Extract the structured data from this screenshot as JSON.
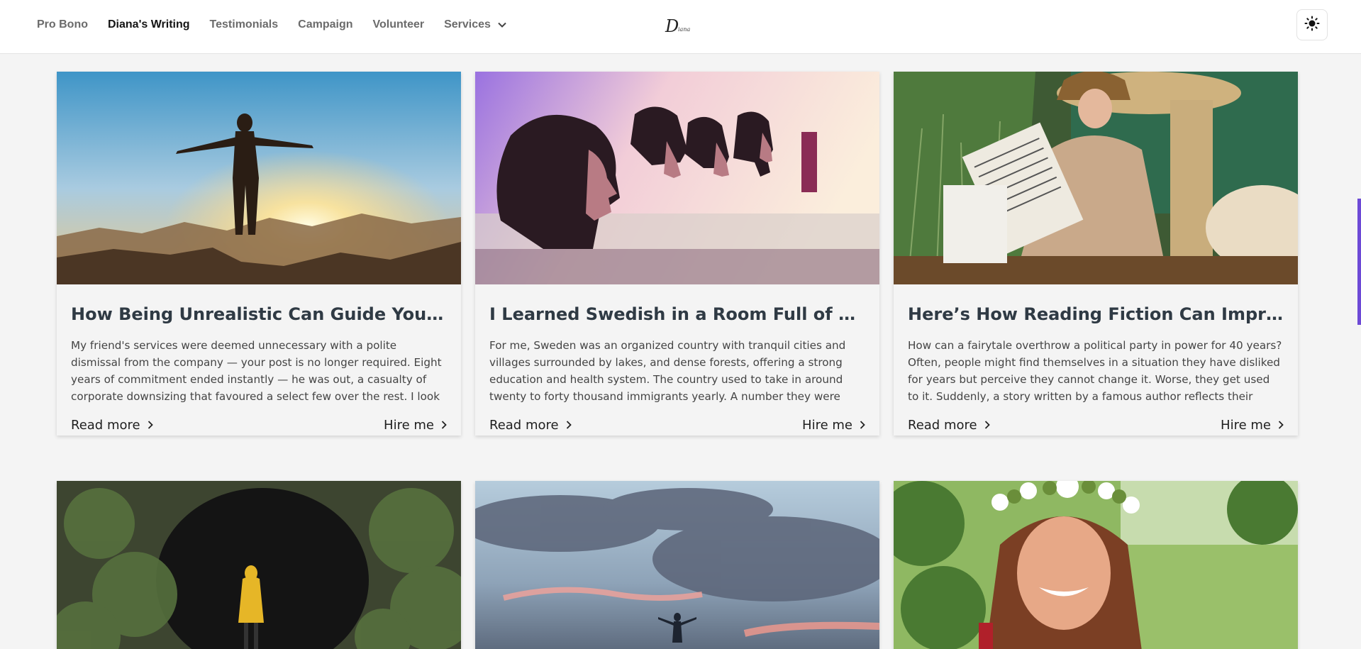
{
  "nav": {
    "items": [
      {
        "label": "Pro Bono"
      },
      {
        "label": "Diana's Writing"
      },
      {
        "label": "Testimonials"
      },
      {
        "label": "Campaign"
      },
      {
        "label": "Volunteer"
      },
      {
        "label": "Services"
      }
    ],
    "active_index": 1,
    "services_icon": "chevron-down-icon"
  },
  "logo": {
    "text": "D",
    "subtext": "iana"
  },
  "theme_toggle": {
    "icon": "sun-icon"
  },
  "colors": {
    "accent": "#6d4ad6",
    "title": "#2f3a44",
    "background": "#f4f4f4"
  },
  "cards": [
    {
      "title": "How Being Unrealistic Can Guide You Throug...",
      "excerpt": "My friend's services were deemed unnecessary with a polite dismissal from the company — your post is no longer required. Eight years of commitment ended instantly — he was out, a casualty of corporate downsizing that favoured a select few over the rest. I look around, and...",
      "read_more": "Read more",
      "hire_me": "Hire me",
      "image": "man-arms-open-sunset-mountains"
    },
    {
      "title": "I Learned Swedish in a Room Full of Refugees",
      "excerpt": "For me, Sweden was an organized country with tranquil cities and villages surrounded by lakes, and dense forests, offering a strong education and health system. The country used to take in around twenty to forty thousand immigrants yearly. A number they were prepared for. But in...",
      "read_more": "Read more",
      "hire_me": "Hire me",
      "image": "four-people-profile-purple-sky"
    },
    {
      "title": "Here’s How Reading Fiction Can Improve You...",
      "excerpt": "How can a fairytale overthrow a political party in power for 40 years? Often, people might find themselves in a situation they have disliked for years but perceive they cannot change it. Worse, they get used to it. Suddenly, a story written by a famous author reflects their situation. It...",
      "read_more": "Read more",
      "hire_me": "Hire me",
      "image": "woman-reading-newspaper-fountain"
    },
    {
      "image": "person-yellow-raincoat-cave"
    },
    {
      "image": "man-arms-open-cloudy-sky"
    },
    {
      "image": "smiling-woman-flower-crown"
    }
  ]
}
